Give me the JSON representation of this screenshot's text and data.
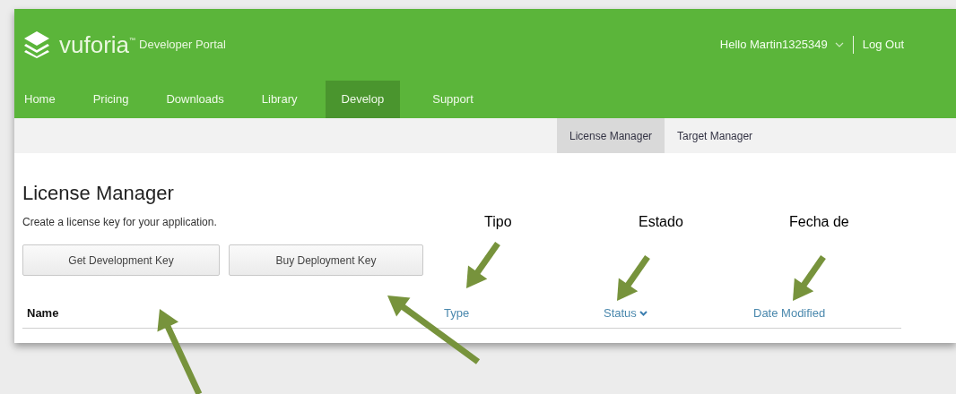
{
  "header": {
    "brand": "vuforia",
    "trademark": "™",
    "portal": "Developer Portal",
    "greeting": "Hello Martin1325349",
    "logout": "Log Out"
  },
  "nav": [
    {
      "label": "Home",
      "selected": false
    },
    {
      "label": "Pricing",
      "selected": false
    },
    {
      "label": "Downloads",
      "selected": false
    },
    {
      "label": "Library",
      "selected": false
    },
    {
      "label": "Develop",
      "selected": true
    },
    {
      "label": "Support",
      "selected": false
    }
  ],
  "subnav": [
    {
      "label": "License Manager",
      "selected": true
    },
    {
      "label": "Target Manager",
      "selected": false
    }
  ],
  "page": {
    "title": "License Manager",
    "subtitle": "Create a license key for your application.",
    "buttons": [
      "Get Development Key",
      "Buy Deployment Key"
    ]
  },
  "table": {
    "columns": [
      {
        "label": "Name",
        "kind": "plain",
        "sorted": false
      },
      {
        "label": "Type",
        "kind": "link",
        "sorted": false
      },
      {
        "label": "Status",
        "kind": "link",
        "sorted": true
      },
      {
        "label": "Date Modified",
        "kind": "link",
        "sorted": false
      }
    ]
  },
  "annotations": [
    "Tipo",
    "Estado",
    "Fecha de"
  ]
}
